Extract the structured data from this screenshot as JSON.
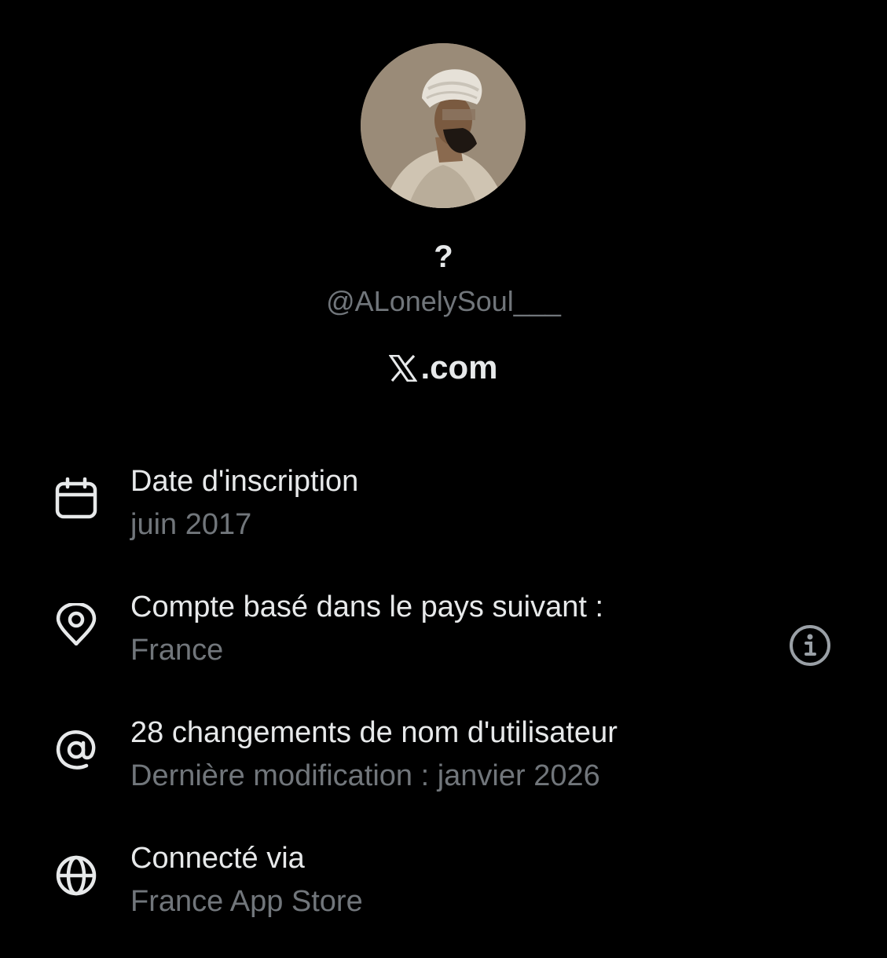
{
  "profile": {
    "display_name": "?",
    "handle": "@ALonelySoul___",
    "site_logo_icon": "x-logo-icon",
    "site_suffix": ".com"
  },
  "info": {
    "joined": {
      "icon": "calendar-icon",
      "title": "Date d'inscription",
      "value": "juin 2017"
    },
    "country": {
      "icon": "location-pin-icon",
      "title": "Compte basé dans le pays suivant :",
      "value": "France",
      "info_icon": "info-circle-icon"
    },
    "username_changes": {
      "icon": "at-sign-icon",
      "title": "28 changements de nom d'utilisateur",
      "value": "Dernière modification : janvier 2026"
    },
    "connected_via": {
      "icon": "globe-icon",
      "title": "Connecté via",
      "value": "France App Store"
    }
  },
  "colors": {
    "background": "#000000",
    "primary_text": "#e7e9ea",
    "secondary_text": "#71767b"
  }
}
